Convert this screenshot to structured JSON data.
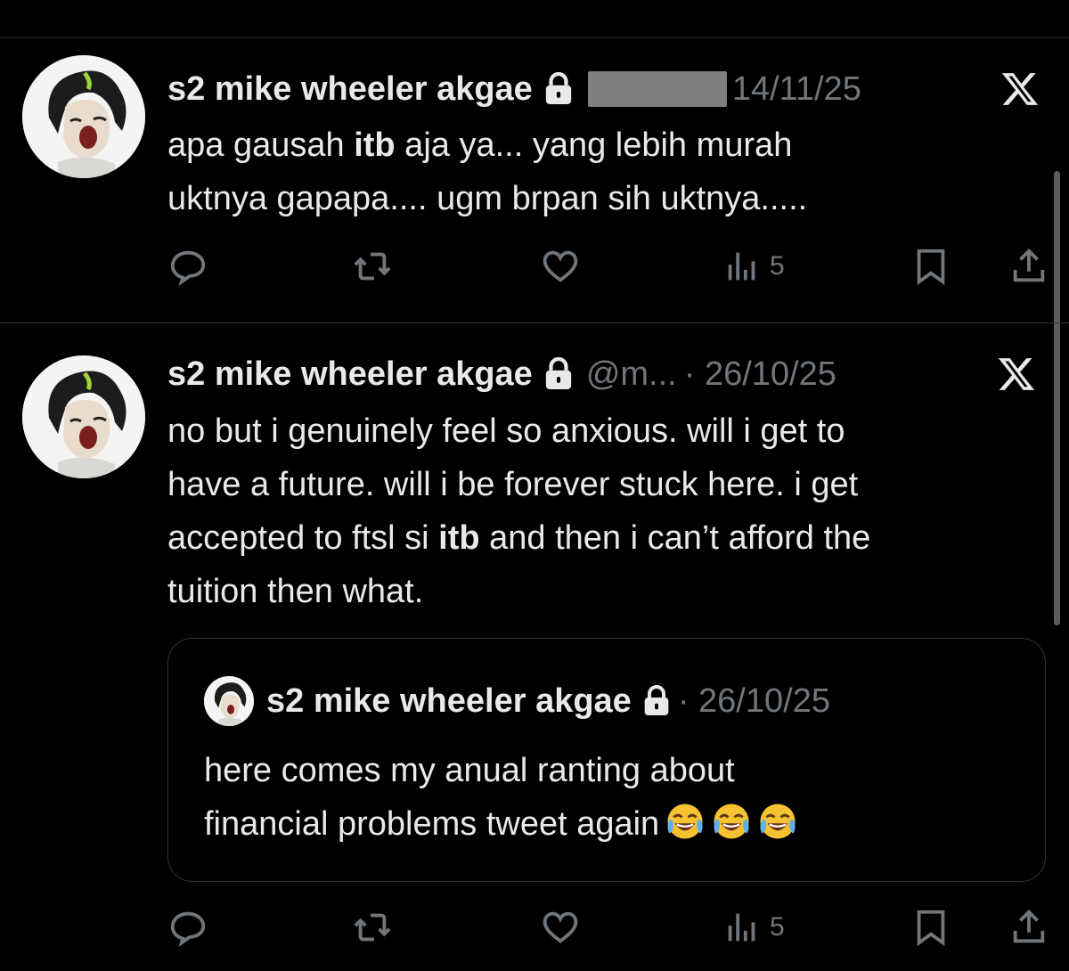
{
  "colors": {
    "background": "#000000",
    "text": "#e7e9ea",
    "muted": "#71767b",
    "divider": "#2f3336"
  },
  "tweets": [
    {
      "author_name": "s2 mike wheeler akgae",
      "date": "14/11/25",
      "text_before": "apa gausah ",
      "text_bold": "itb",
      "text_after": " aja ya... yang lebih murah\nuktnya gapapa.... ugm brpan sih uktnya.....",
      "views": "5",
      "icons": [
        "reply-icon",
        "retweet-icon",
        "like-icon",
        "views-icon",
        "bookmark-icon",
        "share-icon"
      ]
    },
    {
      "author_name": "s2 mike wheeler akgae",
      "handle": "@m...",
      "date": "· 26/10/25",
      "text_before": "no but i genuinely feel so anxious. will i get to\nhave a future. will i be forever stuck here. i get\naccepted to ftsl si ",
      "text_bold": "itb",
      "text_after": " and then i can’t afford the\ntuition then what.",
      "quote": {
        "author_name": "s2 mike wheeler akgae",
        "date": "· 26/10/25",
        "text": "here comes my anual ranting about\nfinancial problems tweet again",
        "emoji": [
          "face-with-tears-of-joy",
          "face-with-tears-of-joy",
          "face-with-tears-of-joy"
        ]
      },
      "views": "5"
    }
  ]
}
